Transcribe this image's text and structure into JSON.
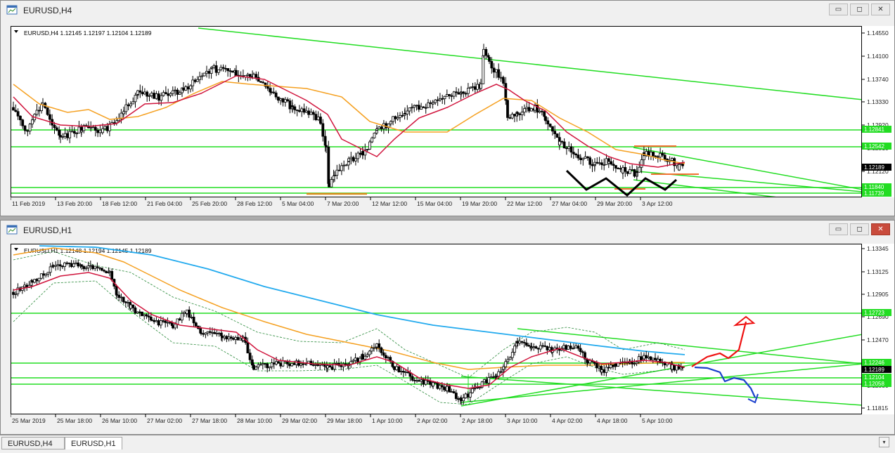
{
  "top": {
    "window_title": "EURUSD,H4",
    "header": "EURUSD,H4  1.12145 1.12197 1.12104 1.12189",
    "price_labels": [
      "1.14550",
      "1.14100",
      "1.13740",
      "1.13330",
      "1.12920",
      "1.12510",
      "1.12120",
      "1.11730"
    ],
    "levels": [
      "1.12841",
      "1.12542",
      "1.12189",
      "1.11840",
      "1.11739"
    ],
    "dates": [
      "11 Feb 2019",
      "13 Feb 20:00",
      "18 Feb 12:00",
      "21 Feb 04:00",
      "25 Feb 20:00",
      "28 Feb 12:00",
      "5 Mar 04:00",
      "7 Mar 20:00",
      "12 Mar 12:00",
      "15 Mar 04:00",
      "19 Mar 20:00",
      "22 Mar 12:00",
      "27 Mar 04:00",
      "29 Mar 20:00",
      "3 Apr 12:00"
    ]
  },
  "bottom": {
    "window_title": "EURUSD,H1",
    "header": "EURUSD,H1  1.12148 1.12194 1.12145 1.12189",
    "price_labels": [
      "1.13345",
      "1.13125",
      "1.12905",
      "1.12690",
      "1.12470",
      "1.12250",
      "1.12030",
      "1.11815"
    ],
    "levels": [
      "1.12723",
      "1.12246",
      "1.12189",
      "1.12104",
      "1.12058"
    ],
    "dates": [
      "25 Mar 2019",
      "25 Mar 18:00",
      "26 Mar 10:00",
      "27 Mar 02:00",
      "27 Mar 18:00",
      "28 Mar 10:00",
      "29 Mar 02:00",
      "29 Mar 18:00",
      "1 Apr 10:00",
      "2 Apr 02:00",
      "2 Apr 18:00",
      "3 Apr 10:00",
      "4 Apr 02:00",
      "4 Apr 18:00",
      "5 Apr 10:00"
    ]
  },
  "tabs": [
    "EURUSD,H4",
    "EURUSD,H1"
  ],
  "window_buttons": {
    "minimize": "▭",
    "maximize": "◻",
    "close": "✕"
  },
  "scroll_button": "▾",
  "colors": {
    "green": "#22dd22",
    "orange": "#f5a020",
    "crimson": "#d0143c",
    "blue": "#22aaee",
    "red_arrow": "#ee1111",
    "blue_arrow": "#1a3fcc"
  }
}
